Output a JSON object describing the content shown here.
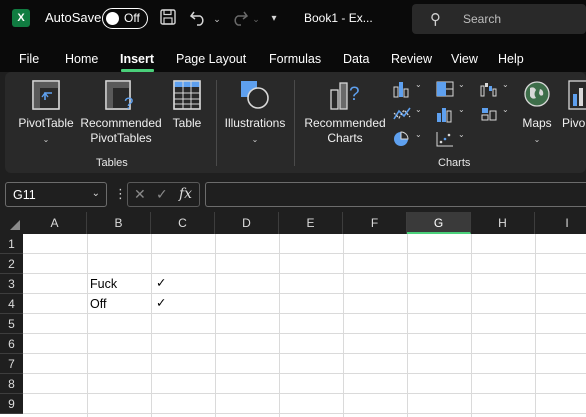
{
  "titlebar": {
    "logo": "X",
    "autosave_label": "AutoSave",
    "autosave_state": "Off",
    "doc_title": "Book1 - Ex...",
    "search_placeholder": "Search",
    "icons": [
      "excel-logo-icon",
      "save-icon",
      "undo-icon",
      "redo-icon",
      "customize-toolbar-icon",
      "search-icon"
    ]
  },
  "menu": {
    "tabs": [
      "File",
      "Home",
      "Insert",
      "Page Layout",
      "Formulas",
      "Data",
      "Review",
      "View",
      "Help"
    ],
    "active": "Insert",
    "accent": "#4ad07a"
  },
  "ribbon": {
    "tables_group": {
      "label": "Tables",
      "buttons": [
        {
          "label_lines": [
            "PivotTable"
          ],
          "has_dropdown": true,
          "icon": "pivottable-icon"
        },
        {
          "label_lines": [
            "Recommended",
            "PivotTables"
          ],
          "has_dropdown": false,
          "icon": "recommended-pivottables-icon"
        },
        {
          "label_lines": [
            "Table"
          ],
          "has_dropdown": false,
          "icon": "table-icon"
        }
      ]
    },
    "illustrations": {
      "label": "Illustrations",
      "has_dropdown": true,
      "icon": "shapes-icon"
    },
    "charts_group": {
      "label": "Charts",
      "recommended": {
        "label_lines": [
          "Recommended",
          "Charts"
        ],
        "icon": "recommended-charts-icon"
      },
      "maps": {
        "label": "Maps",
        "icon": "globe-icon"
      },
      "pivot_truncated": "Pivo",
      "mini_icons": [
        "column-chart-icon",
        "hierarchy-chart-icon",
        "waterfall-chart-icon",
        "line-chart-icon",
        "bar-chart-icon",
        "statistic-chart-icon",
        "pie-chart-icon",
        "scatter-chart-icon"
      ]
    }
  },
  "formula_bar": {
    "name_box": "G11",
    "fx_label": "fx",
    "cancel_glyph": "✕",
    "enter_glyph": "✓",
    "value": ""
  },
  "sheet": {
    "selected_column": "G",
    "columns": [
      "A",
      "B",
      "C",
      "D",
      "E",
      "F",
      "G",
      "H",
      "I"
    ],
    "rows": [
      "1",
      "2",
      "3",
      "4",
      "5",
      "6",
      "7",
      "8",
      "9"
    ],
    "cells": {
      "B3": "Fuck",
      "B4": "Off",
      "C3": "✓",
      "C4": "✓"
    }
  }
}
